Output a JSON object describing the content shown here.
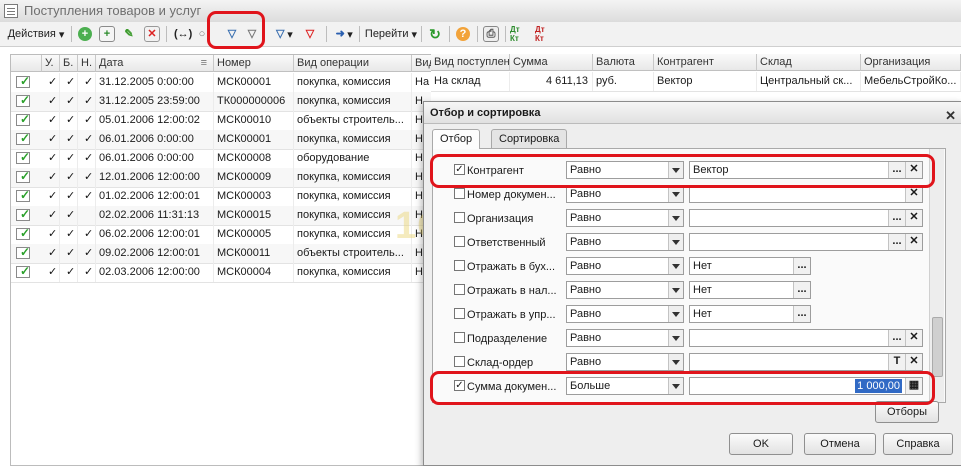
{
  "window": {
    "title": "Поступления товаров и услуг"
  },
  "toolbar": {
    "actions_label": "Действия",
    "goto_label": "Перейти",
    "dt_kt_1": "Дт Кт",
    "dt_kt_2": "Дт Кт"
  },
  "table": {
    "columns": [
      "",
      "У.",
      "Б.",
      "Н.",
      "Дата",
      "Номер",
      "Вид операции",
      "Вид поступления",
      "Сумма",
      "Валюта",
      "Контрагент",
      "Склад",
      "Организация"
    ],
    "rows": [
      {
        "u": "✓",
        "b": "✓",
        "n": "✓",
        "date": "31.12.2005 0:00:00",
        "num": "МСК00001",
        "op": "покупка, комиссия",
        "recv": "На склад",
        "sum": "4 611,13",
        "cur": "руб.",
        "agent": "Вектор",
        "store": "Центральный ск...",
        "org": "МебельСтройКо..."
      },
      {
        "u": "✓",
        "b": "✓",
        "n": "✓",
        "date": "31.12.2005 23:59:00",
        "num": "ТК000000006",
        "op": "покупка, комиссия",
        "recv": "Н"
      },
      {
        "u": "✓",
        "b": "✓",
        "n": "✓",
        "date": "05.01.2006 12:00:02",
        "num": "МСК00010",
        "op": "объекты строитель...",
        "recv": "Н"
      },
      {
        "u": "✓",
        "b": "✓",
        "n": "✓",
        "date": "06.01.2006 0:00:00",
        "num": "МСК00001",
        "op": "покупка, комиссия",
        "recv": "Н"
      },
      {
        "u": "✓",
        "b": "✓",
        "n": "✓",
        "date": "06.01.2006 0:00:00",
        "num": "МСК00008",
        "op": "оборудование",
        "recv": "Н"
      },
      {
        "u": "✓",
        "b": "✓",
        "n": "✓",
        "date": "12.01.2006 12:00:00",
        "num": "МСК00009",
        "op": "покупка, комиссия",
        "recv": "Н"
      },
      {
        "u": "✓",
        "b": "✓",
        "n": "✓",
        "date": "01.02.2006 12:00:01",
        "num": "МСК00003",
        "op": "покупка, комиссия",
        "recv": "Н"
      },
      {
        "u": "✓",
        "b": "✓",
        "n": "",
        "date": "02.02.2006 11:31:13",
        "num": "МСК00015",
        "op": "покупка, комиссия",
        "recv": "Н"
      },
      {
        "u": "✓",
        "b": "✓",
        "n": "✓",
        "date": "06.02.2006 12:00:01",
        "num": "МСК00005",
        "op": "покупка, комиссия",
        "recv": "Н"
      },
      {
        "u": "✓",
        "b": "✓",
        "n": "✓",
        "date": "09.02.2006 12:00:01",
        "num": "МСК00011",
        "op": "объекты строитель...",
        "recv": "Н"
      },
      {
        "u": "✓",
        "b": "✓",
        "n": "✓",
        "date": "02.03.2006 12:00:00",
        "num": "МСК00004",
        "op": "покупка, комиссия",
        "recv": "Н"
      }
    ]
  },
  "dialog": {
    "title": "Отбор и сортировка",
    "tabs": [
      "Отбор",
      "Сортировка"
    ],
    "filters": [
      {
        "checked": true,
        "name": "Контрагент",
        "cmp": "Равно",
        "value": "Вектор",
        "buttons": [
          "...",
          "✕"
        ]
      },
      {
        "checked": false,
        "name": "Номер докумен...",
        "cmp": "Равно",
        "value": "",
        "buttons": [
          "✕"
        ]
      },
      {
        "checked": false,
        "name": "Организация",
        "cmp": "Равно",
        "value": "",
        "buttons": [
          "...",
          "✕"
        ]
      },
      {
        "checked": false,
        "name": "Ответственный",
        "cmp": "Равно",
        "value": "",
        "buttons": [
          "...",
          "✕"
        ]
      },
      {
        "checked": false,
        "name": "Отражать в бух...",
        "cmp": "Равно",
        "value": "Нет",
        "buttons": [
          "..."
        ]
      },
      {
        "checked": false,
        "name": "Отражать в нал...",
        "cmp": "Равно",
        "value": "Нет",
        "buttons": [
          "..."
        ]
      },
      {
        "checked": false,
        "name": "Отражать в упр...",
        "cmp": "Равно",
        "value": "Нет",
        "buttons": [
          "..."
        ]
      },
      {
        "checked": false,
        "name": "Подразделение",
        "cmp": "Равно",
        "value": "",
        "buttons": [
          "...",
          "✕"
        ]
      },
      {
        "checked": false,
        "name": "Склад-ордер",
        "cmp": "Равно",
        "value": "",
        "buttons": [
          "T",
          "✕"
        ]
      },
      {
        "checked": true,
        "name": "Сумма докумен...",
        "cmp": "Больше",
        "value": "1 000,00",
        "buttons": [
          "▦"
        ]
      }
    ],
    "filters_button": "Отборы",
    "ok_button": "OK",
    "cancel_button": "Отмена",
    "help_button": "Справка"
  },
  "watermark": "1C.RU",
  "colors": {
    "highlight_ring": "#e0141b",
    "selection": "#316ac5"
  }
}
